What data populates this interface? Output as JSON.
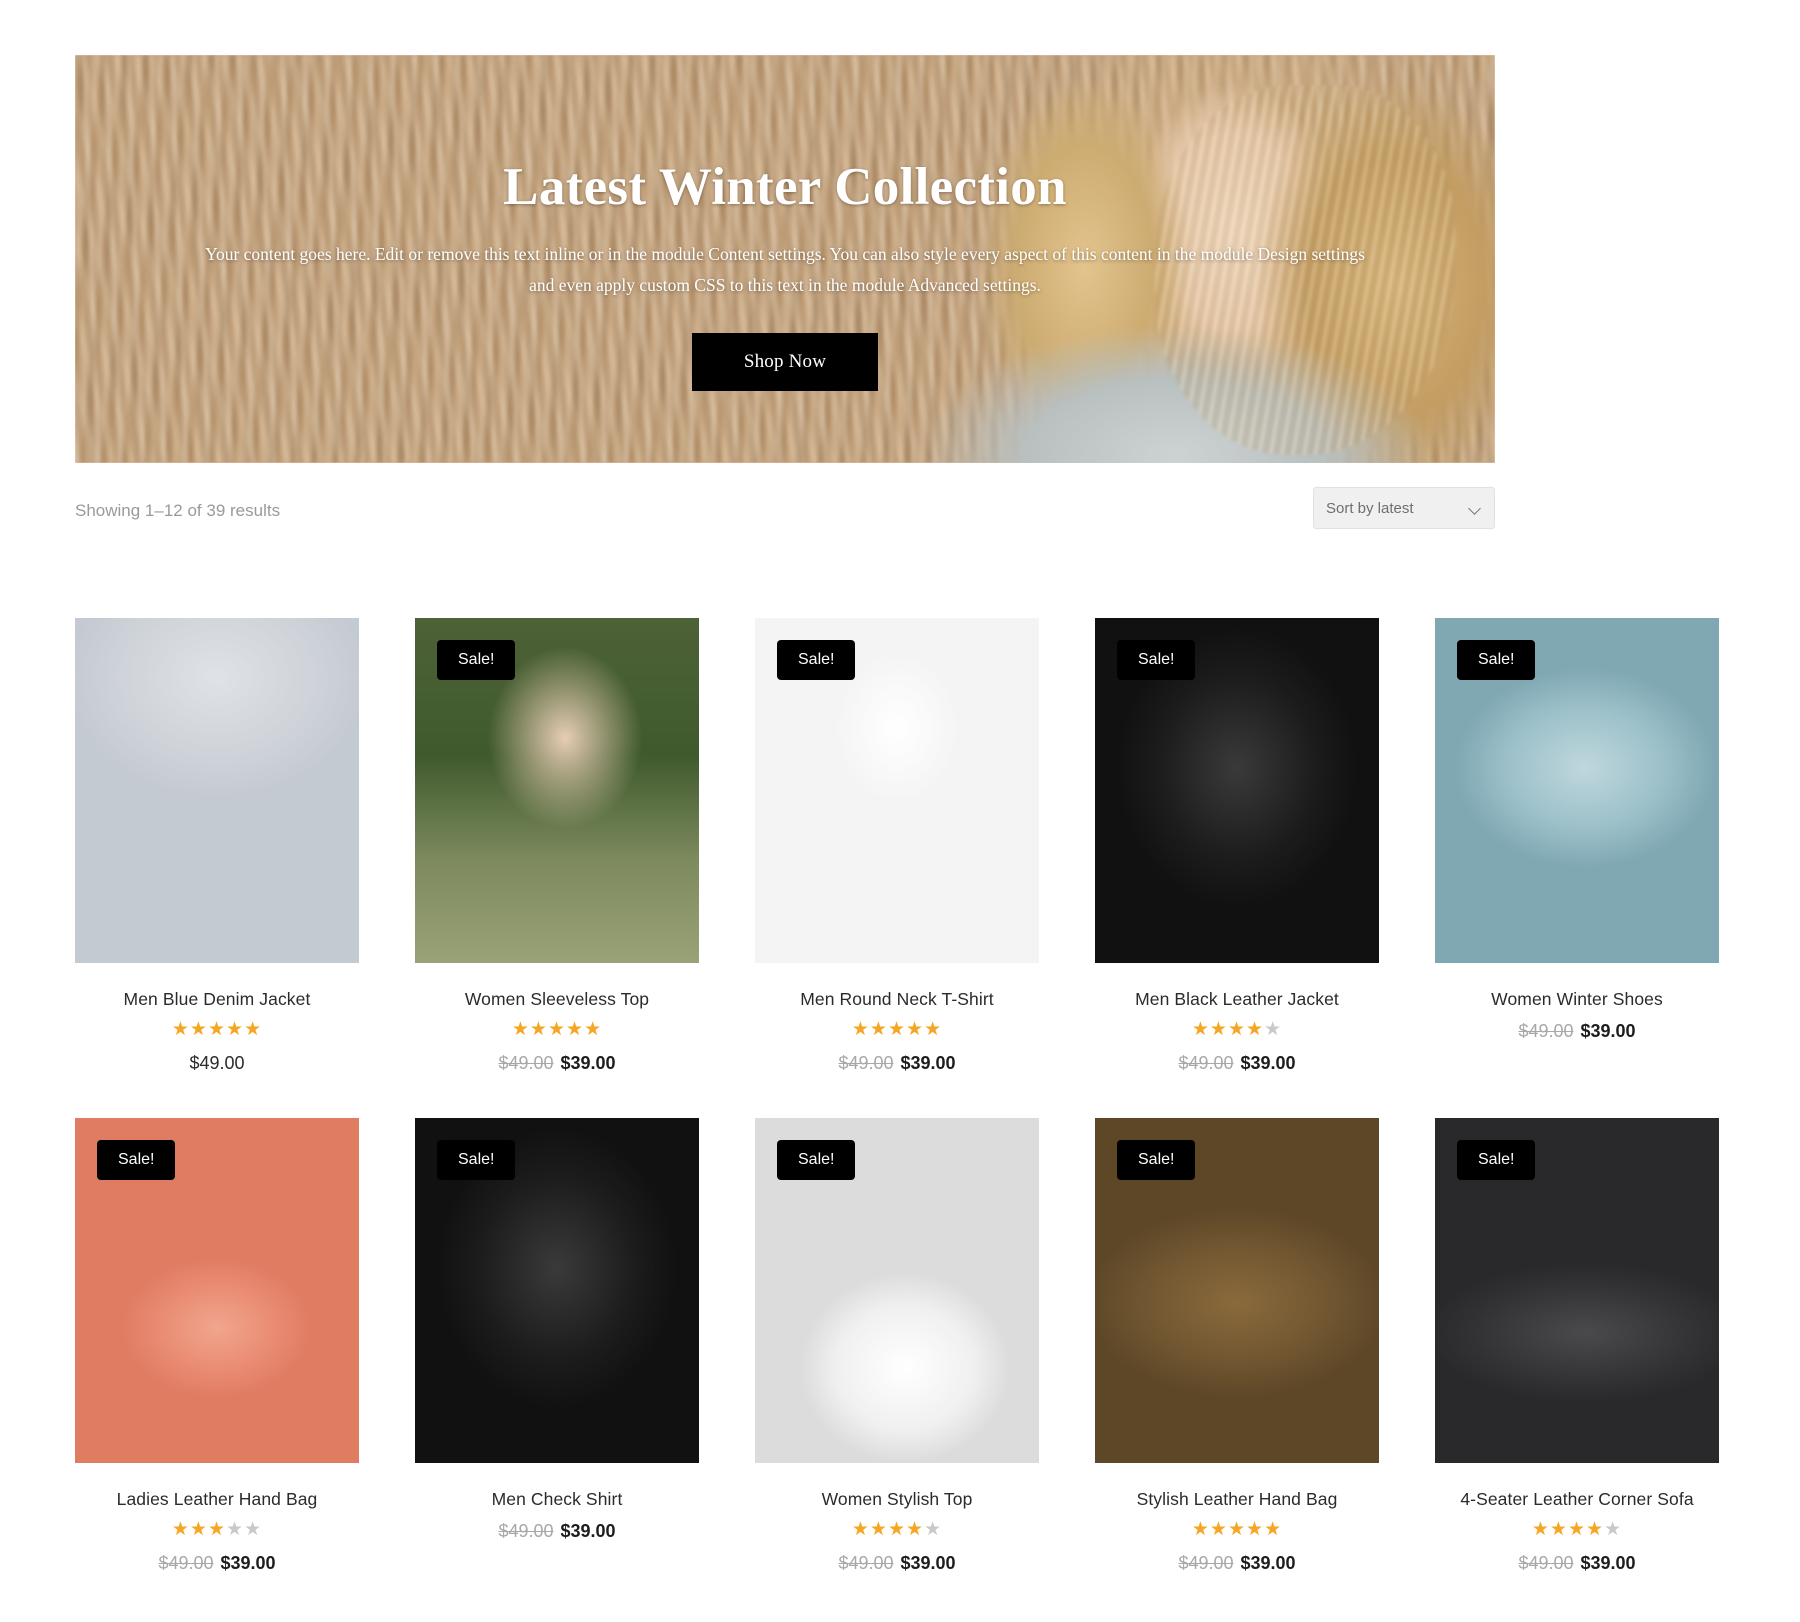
{
  "hero": {
    "title": "Latest Winter Collection",
    "subtitle": "Your content goes here. Edit or remove this text inline or in the module Content settings. You can also style every aspect of this content in the module Design settings and even apply custom CSS to this text in the module Advanced settings.",
    "cta_label": "Shop Now"
  },
  "toolbar": {
    "results_text": "Showing 1–12 of 39 results",
    "sort_selected": "Sort by latest",
    "sort_options": [
      "Sort by latest"
    ]
  },
  "labels": {
    "sale_badge": "Sale!",
    "star_filled": "★",
    "star_empty": "★"
  },
  "colors": {
    "star_filled": "#f5a623",
    "star_empty": "#c9c9c9",
    "badge_bg": "#000000",
    "cta_bg": "#000000",
    "price_old": "#a8a8a8"
  },
  "products": [
    {
      "title": "Men Blue Denim Jacket",
      "on_sale": false,
      "rating": 5,
      "has_rating": true,
      "price_old": "",
      "price": "$49.00",
      "image": "men-blue-denim-jacket"
    },
    {
      "title": "Women Sleeveless Top",
      "on_sale": true,
      "rating": 5,
      "has_rating": true,
      "price_old": "$49.00",
      "price": "$39.00",
      "image": "women-sleeveless-top"
    },
    {
      "title": "Men Round Neck T-Shirt",
      "on_sale": true,
      "rating": 5,
      "has_rating": true,
      "price_old": "$49.00",
      "price": "$39.00",
      "image": "men-round-neck-tshirt"
    },
    {
      "title": "Men Black Leather Jacket",
      "on_sale": true,
      "rating": 4,
      "has_rating": true,
      "price_old": "$49.00",
      "price": "$39.00",
      "image": "men-black-leather-jacket"
    },
    {
      "title": "Women Winter Shoes",
      "on_sale": true,
      "rating": 0,
      "has_rating": false,
      "price_old": "$49.00",
      "price": "$39.00",
      "image": "women-winter-shoes"
    },
    {
      "title": "Ladies Leather Hand Bag",
      "on_sale": true,
      "rating": 3,
      "has_rating": true,
      "price_old": "$49.00",
      "price": "$39.00",
      "image": "ladies-leather-hand-bag"
    },
    {
      "title": "Men Check Shirt",
      "on_sale": true,
      "rating": 0,
      "has_rating": false,
      "price_old": "$49.00",
      "price": "$39.00",
      "image": "men-check-shirt"
    },
    {
      "title": "Women Stylish Top",
      "on_sale": true,
      "rating": 4,
      "has_rating": true,
      "price_old": "$49.00",
      "price": "$39.00",
      "image": "women-stylish-top"
    },
    {
      "title": "Stylish Leather Hand Bag",
      "on_sale": true,
      "rating": 5,
      "has_rating": true,
      "price_old": "$49.00",
      "price": "$39.00",
      "image": "stylish-leather-hand-bag"
    },
    {
      "title": "4-Seater Leather Corner Sofa",
      "on_sale": true,
      "rating": 4,
      "has_rating": true,
      "price_old": "$49.00",
      "price": "$39.00",
      "image": "four-seater-leather-corner-sofa"
    }
  ]
}
